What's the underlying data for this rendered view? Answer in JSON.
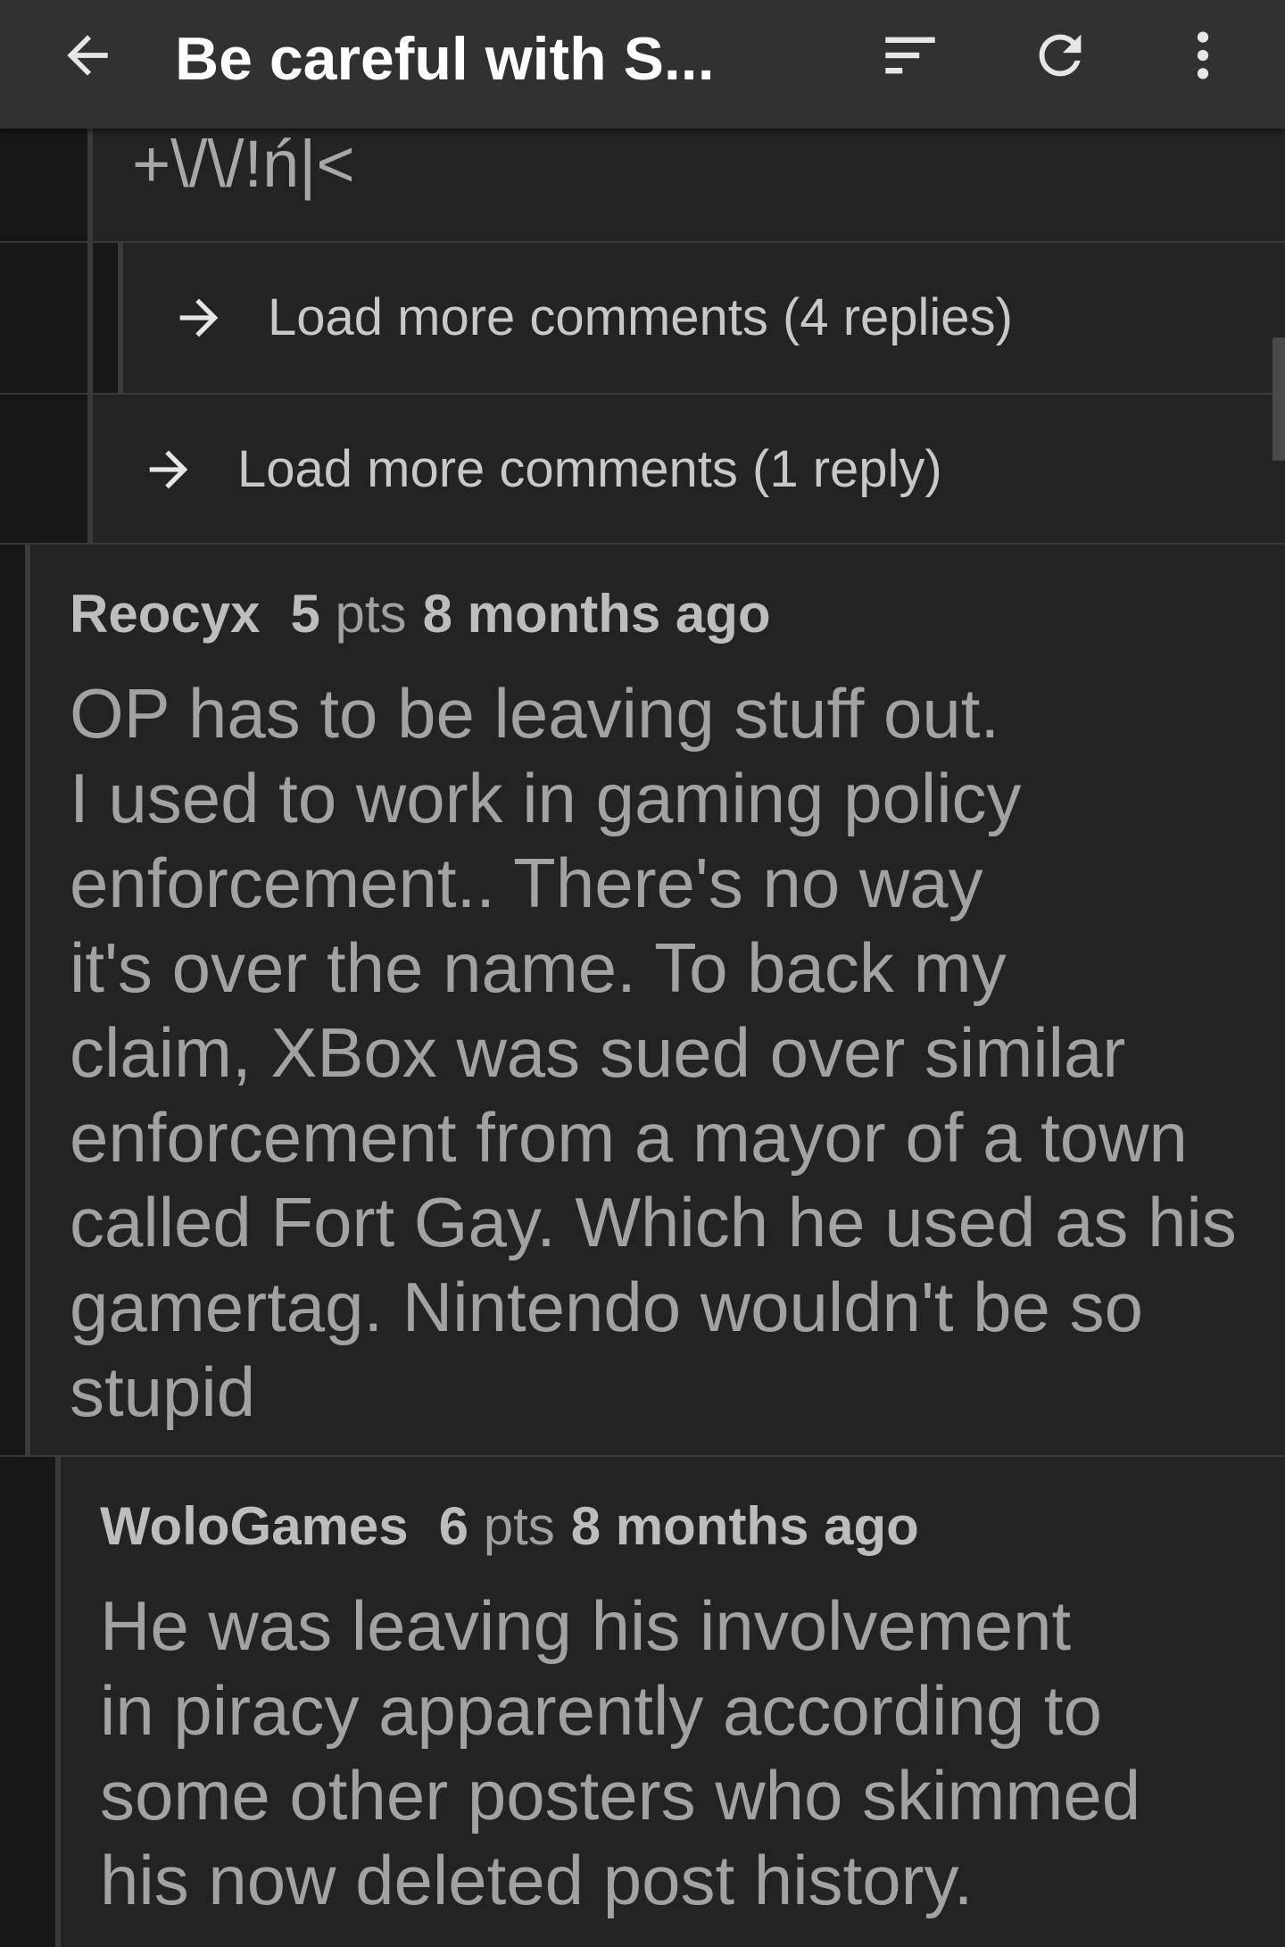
{
  "app_bar": {
    "title": "Be careful with S...",
    "back_icon": "arrow-left-icon",
    "sort_icon": "sort-lines-icon",
    "refresh_icon": "refresh-icon",
    "overflow_icon": "more-vertical-icon"
  },
  "feed": {
    "signature": "+\\/\\/!ń|<",
    "load_more_1": {
      "label": "Load more comments (4 replies)",
      "icon": "arrow-right-icon"
    },
    "load_more_2": {
      "label": "Load more comments (1 reply)",
      "icon": "arrow-right-icon"
    },
    "comments": [
      {
        "author": "Reocyx",
        "score": "5",
        "pts_label": "pts",
        "age": "8 months ago",
        "body_lines": [
          "OP has to be leaving stuff out.",
          "I used to work in gaming policy",
          "enforcement.. There's no way",
          "it's over the name. To back my",
          "claim, XBox was sued over similar",
          "enforcement from a mayor of a town",
          "called Fort Gay. Which he used as his",
          "gamertag. Nintendo wouldn't be so",
          "stupid"
        ]
      },
      {
        "author": "WoloGames",
        "score": "6",
        "pts_label": "pts",
        "age": "8 months ago",
        "body_lines": [
          "He was leaving his involvement",
          "in piracy apparently according to",
          "some other posters who skimmed",
          "his now deleted post history."
        ]
      }
    ]
  }
}
